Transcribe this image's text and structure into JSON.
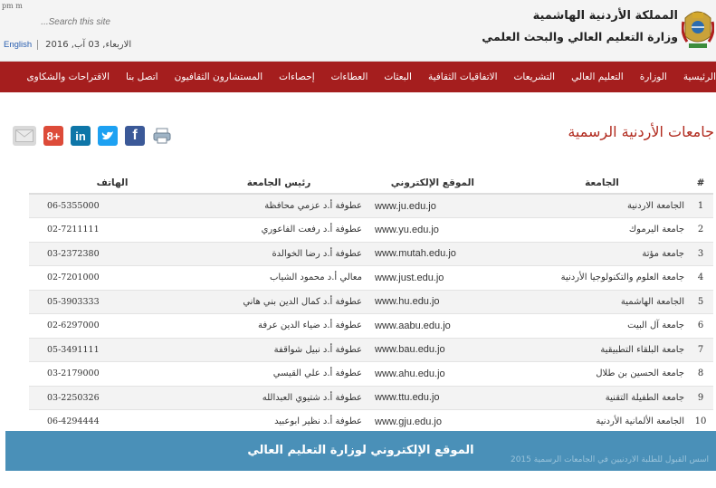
{
  "header": {
    "logo_alt": "jordan-coat-of-arms",
    "title_line1": "المملكة الأردنية الهاشمية",
    "title_line2": "وزارة التعليم العالي والبحث العلمي",
    "tiny_top": "pm m",
    "search_placeholder": "...Search this site",
    "lang_link": "English",
    "date": "الاربعاء, 03 آب, 2016"
  },
  "nav": {
    "items": [
      "الرئيسية",
      "الوزارة",
      "التعليم العالي",
      "التشريعات",
      "الاتفاقيات الثقافية",
      "البعثات",
      "العطاءات",
      "إحصاءات",
      "المستشارون الثقافيون",
      "اتصل بنا",
      "الاقتراحات والشكاوى"
    ]
  },
  "page": {
    "title": "جامعات الأردنية الرسمية"
  },
  "share_icons": [
    {
      "name": "print-icon",
      "glyph": "🖨",
      "color": "#ffffff"
    },
    {
      "name": "facebook-icon",
      "glyph": "f",
      "color": "#3b5998"
    },
    {
      "name": "twitter-icon",
      "glyph": "t",
      "color": "#1da1f2"
    },
    {
      "name": "linkedin-icon",
      "glyph": "in",
      "color": "#0e76a8"
    },
    {
      "name": "googleplus-icon",
      "glyph": "8+",
      "color": "#dd4b39"
    },
    {
      "name": "email-icon",
      "glyph": "✉",
      "color": "#cfcfcf"
    }
  ],
  "table": {
    "headers": {
      "num": "#",
      "university": "الجامعة",
      "website": "الموقع الإلكتروني",
      "president": "رئيس الجامعة",
      "phone": "الهاتف"
    },
    "rows": [
      {
        "num": "1",
        "university": "الجامعة الاردنية",
        "website": "www.ju.edu.jo",
        "president": "عطوفة أ.د عزمي محافظة",
        "phone": "06-5355000"
      },
      {
        "num": "2",
        "university": "جامعة اليرموك",
        "website": "www.yu.edu.jo",
        "president": "عطوفة أ.د رفعت الفاعوري",
        "phone": "02-7211111"
      },
      {
        "num": "3",
        "university": "جامعة مؤتة",
        "website": "www.mutah.edu.jo",
        "president": "عطوفة أ.د رضا الخوالدة",
        "phone": "03-2372380"
      },
      {
        "num": "4",
        "university": "جامعة العلوم والتكنولوجيا الأردنية",
        "website": "www.just.edu.jo",
        "president": "معالي أ.د محمود الشياب",
        "phone": "02-7201000"
      },
      {
        "num": "5",
        "university": "الجامعة الهاشمية",
        "website": "www.hu.edu.jo",
        "president": "عطوفة أ.د كمال الدين بني هاني",
        "phone": "05-3903333"
      },
      {
        "num": "6",
        "university": "جامعة آل البيت",
        "website": "www.aabu.edu.jo",
        "president": "عطوفة أ.د ضياء الدين عرفة",
        "phone": "02-6297000"
      },
      {
        "num": "7",
        "university": "جامعة البلقاء التطبيقية",
        "website": "www.bau.edu.jo",
        "president": "عطوفة أ.د نبيل شواقفة",
        "phone": "05-3491111"
      },
      {
        "num": "8",
        "university": "جامعة الحسين بن طلال",
        "website": "www.ahu.edu.jo",
        "president": "عطوفة أ.د علي القيسي",
        "phone": "03-2179000"
      },
      {
        "num": "9",
        "university": "جامعة الطفيلة التقنية",
        "website": "www.ttu.edu.jo",
        "president": "عطوفة أ.د شتيوي العبدالله",
        "phone": "03-2250326"
      },
      {
        "num": "10",
        "university": "الجامعة الألمانية الأردنية",
        "website": "www.gju.edu.jo",
        "president": "عطوفة أ.د نظير ابوعبيد",
        "phone": "06-4294444"
      }
    ]
  },
  "caption": {
    "text": "الموقع الإلكتروني لوزارة التعليم العالي",
    "note": "اسس القبول للطلبة الاردنيين في الجامعات الرسمية 2015"
  },
  "colors": {
    "nav_bg": "#a51e1e",
    "title_red": "#b12a1e",
    "caption_bg": "#4a90b8",
    "link_blue": "#3a6ec0"
  }
}
